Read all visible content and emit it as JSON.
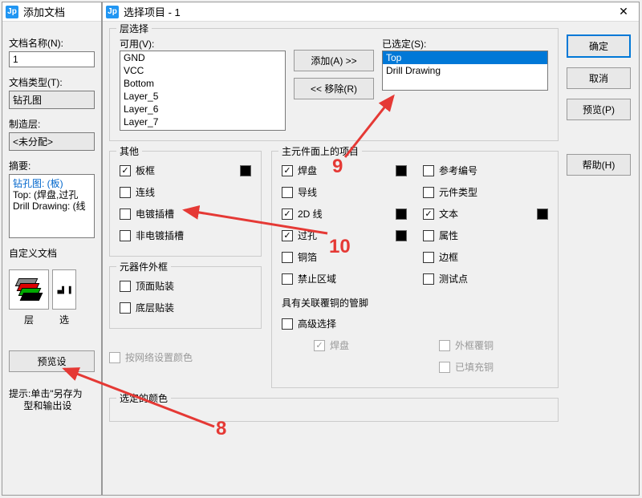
{
  "window1": {
    "title": "添加文档",
    "docNameLabel": "文档名称(N):",
    "docNameValue": "1",
    "docTypeLabel": "文档类型(T):",
    "docTypeValue": "钻孔图",
    "mfgLayerLabel": "制造层:",
    "mfgLayerValue": "<未分配>",
    "summaryLabel": "摘要:",
    "summary": [
      {
        "cls": "blue-text",
        "text": "钻孔图: (板)"
      },
      {
        "cls": "",
        "text": "Top: (焊盘,过孔"
      },
      {
        "cls": "",
        "text": "Drill Drawing: (线"
      }
    ],
    "customDocLabel": "自定义文档",
    "iconLabelLayer": "层",
    "iconLabelSel": "选",
    "previewBtn": "预览设",
    "tipLabel1": "提示:单击\"另存为",
    "tipLabel2": "型和输出设"
  },
  "window2": {
    "title": "选择项目 - 1",
    "layerSelectLegend": "层选择",
    "availableLabel": "可用(V):",
    "availableItems": [
      "GND",
      "VCC",
      "Bottom",
      "Layer_5",
      "Layer_6",
      "Layer_7"
    ],
    "addBtn": "添加(A) >>",
    "removeBtn": "<< 移除(R)",
    "selectedLabel": "已选定(S):",
    "selectedItems": [
      {
        "text": "Top",
        "selected": true
      },
      {
        "text": "Drill Drawing",
        "selected": false
      }
    ],
    "otherLegend": "其他",
    "otherItems": [
      {
        "label": "板框",
        "checked": true,
        "swatch": true
      },
      {
        "label": "连线",
        "checked": false,
        "swatch": false
      },
      {
        "label": "电镀插槽",
        "checked": false,
        "swatch": false
      },
      {
        "label": "非电镀插槽",
        "checked": false,
        "swatch": false
      }
    ],
    "outlineLegend": "元器件外框",
    "outlineItems": [
      {
        "label": "顶面贴装",
        "checked": false
      },
      {
        "label": "底层贴装",
        "checked": false
      }
    ],
    "byNetColorLabel": "按网络设置颜色",
    "primaryLegend": "主元件面上的项目",
    "primaryItemsCol1": [
      {
        "label": "焊盘",
        "checked": true,
        "swatch": true
      },
      {
        "label": "导线",
        "checked": false,
        "swatch": false
      },
      {
        "label": "2D 线",
        "checked": true,
        "swatch": true
      },
      {
        "label": "过孔",
        "checked": true,
        "swatch": true
      },
      {
        "label": "铜箔",
        "checked": false,
        "swatch": false
      },
      {
        "label": "禁止区域",
        "checked": false,
        "swatch": false
      }
    ],
    "primaryItemsCol2": [
      {
        "label": "参考编号",
        "checked": false,
        "swatch": false
      },
      {
        "label": "元件类型",
        "checked": false,
        "swatch": false
      },
      {
        "label": "文本",
        "checked": true,
        "swatch": true
      },
      {
        "label": "属性",
        "checked": false,
        "swatch": false
      },
      {
        "label": "边框",
        "checked": false,
        "swatch": false
      },
      {
        "label": "测试点",
        "checked": false,
        "swatch": false
      }
    ],
    "assocCopperLegend": "具有关联覆铜的管脚",
    "advancedSelLabel": "高级选择",
    "advItems": [
      {
        "label": "焊盘",
        "checked": true,
        "disabled": true
      },
      {
        "label": "外框覆铜",
        "checked": false,
        "disabled": true
      },
      {
        "label": "",
        "checked": false,
        "disabled": true,
        "hidden": true
      },
      {
        "label": "已填充铜",
        "checked": false,
        "disabled": true
      }
    ],
    "selectedColorLegend": "选定的颜色",
    "buttons": {
      "ok": "确定",
      "cancel": "取消",
      "preview": "预览(P)",
      "help": "帮助(H)"
    }
  },
  "annotations": {
    "n8": "8",
    "n9": "9",
    "n10": "10"
  }
}
